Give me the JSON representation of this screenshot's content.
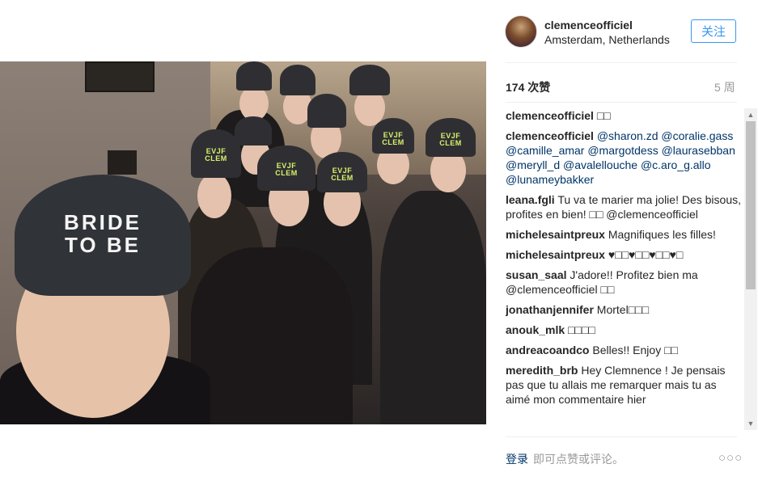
{
  "post": {
    "username": "clemenceofficiel",
    "location": "Amsterdam, Netherlands",
    "follow_label": "关注",
    "likes": "174 次赞",
    "time_ago": "5 周",
    "photo_text": {
      "big_beanie": "BRIDE\nTO BE",
      "small_beanie": "EVJF\nCLEM"
    }
  },
  "comments": [
    {
      "user": "clemenceofficiel",
      "text": "□□"
    },
    {
      "user": "clemenceofficiel",
      "text": "@sharon.zd @coralie.gass @camille_amar @margotdess @laurasebban @meryll_d @avalellouche @c.aro_g.allo @lunameybakker"
    },
    {
      "user": "leana.fgli",
      "text": "Tu va te marier ma jolie! Des bisous, profites en bien! □□ @clemenceofficiel"
    },
    {
      "user": "michelesaintpreux",
      "text": "Magnifiques les filles!"
    },
    {
      "user": "michelesaintpreux",
      "text": "♥□□♥□□♥□□♥□"
    },
    {
      "user": "susan_saal",
      "text": "J'adore!! Profitez bien ma @clemenceofficiel □□"
    },
    {
      "user": "jonathanjennifer",
      "text": "Mortel□□□"
    },
    {
      "user": "anouk_mlk",
      "text": "□□□□"
    },
    {
      "user": "andreacoandco",
      "text": "Belles!! Enjoy □□"
    },
    {
      "user": "meredith_brb",
      "text": "Hey Clemnence ! Je pensais pas que tu allais me remarquer mais tu as aimé mon commentaire hier"
    }
  ],
  "footer": {
    "login_label": "登录",
    "login_hint": "即可点赞或评论。",
    "more_icon": "○○○"
  },
  "scrollbar": {
    "up_arrow": "▲",
    "down_arrow": "▼"
  }
}
